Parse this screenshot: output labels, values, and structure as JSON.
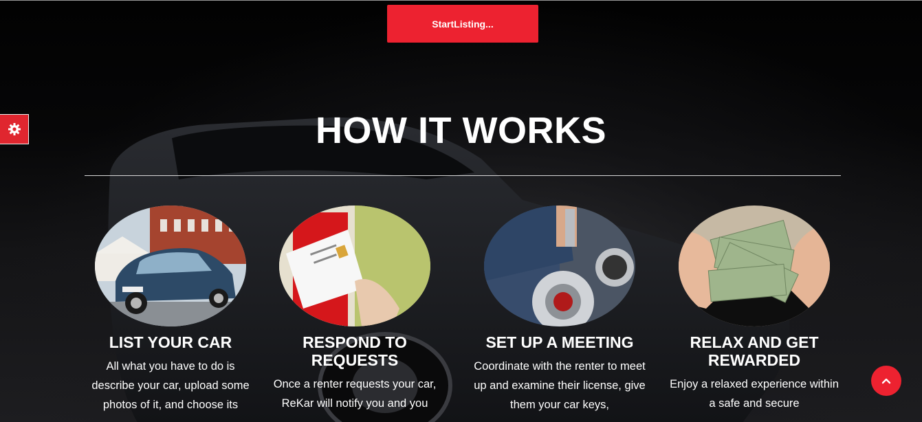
{
  "cta": {
    "label": "StartListing..."
  },
  "section": {
    "title": "HOW IT WORKS"
  },
  "steps": [
    {
      "title": "LIST YOUR CAR",
      "text": "All what you have to do is describe your car, upload some photos of it, and choose its",
      "image": "car-photo"
    },
    {
      "title": "RESPOND TO REQUESTS",
      "text": "Once a renter requests your car, ReKar will notify you and you",
      "image": "mail-photo"
    },
    {
      "title": "SET UP A MEETING",
      "text": "Coordinate with the renter to meet up and examine their license, give them your car keys,",
      "image": "car-keys-photo"
    },
    {
      "title": "RELAX AND GET REWARDED",
      "text": "Enjoy a relaxed experience within a safe and secure",
      "image": "money-photo"
    }
  ],
  "icons": {
    "settings": "gear-icon",
    "scroll_top": "chevron-up-icon"
  },
  "colors": {
    "accent": "#ed2230",
    "text": "#ffffff",
    "background": "#000000"
  }
}
